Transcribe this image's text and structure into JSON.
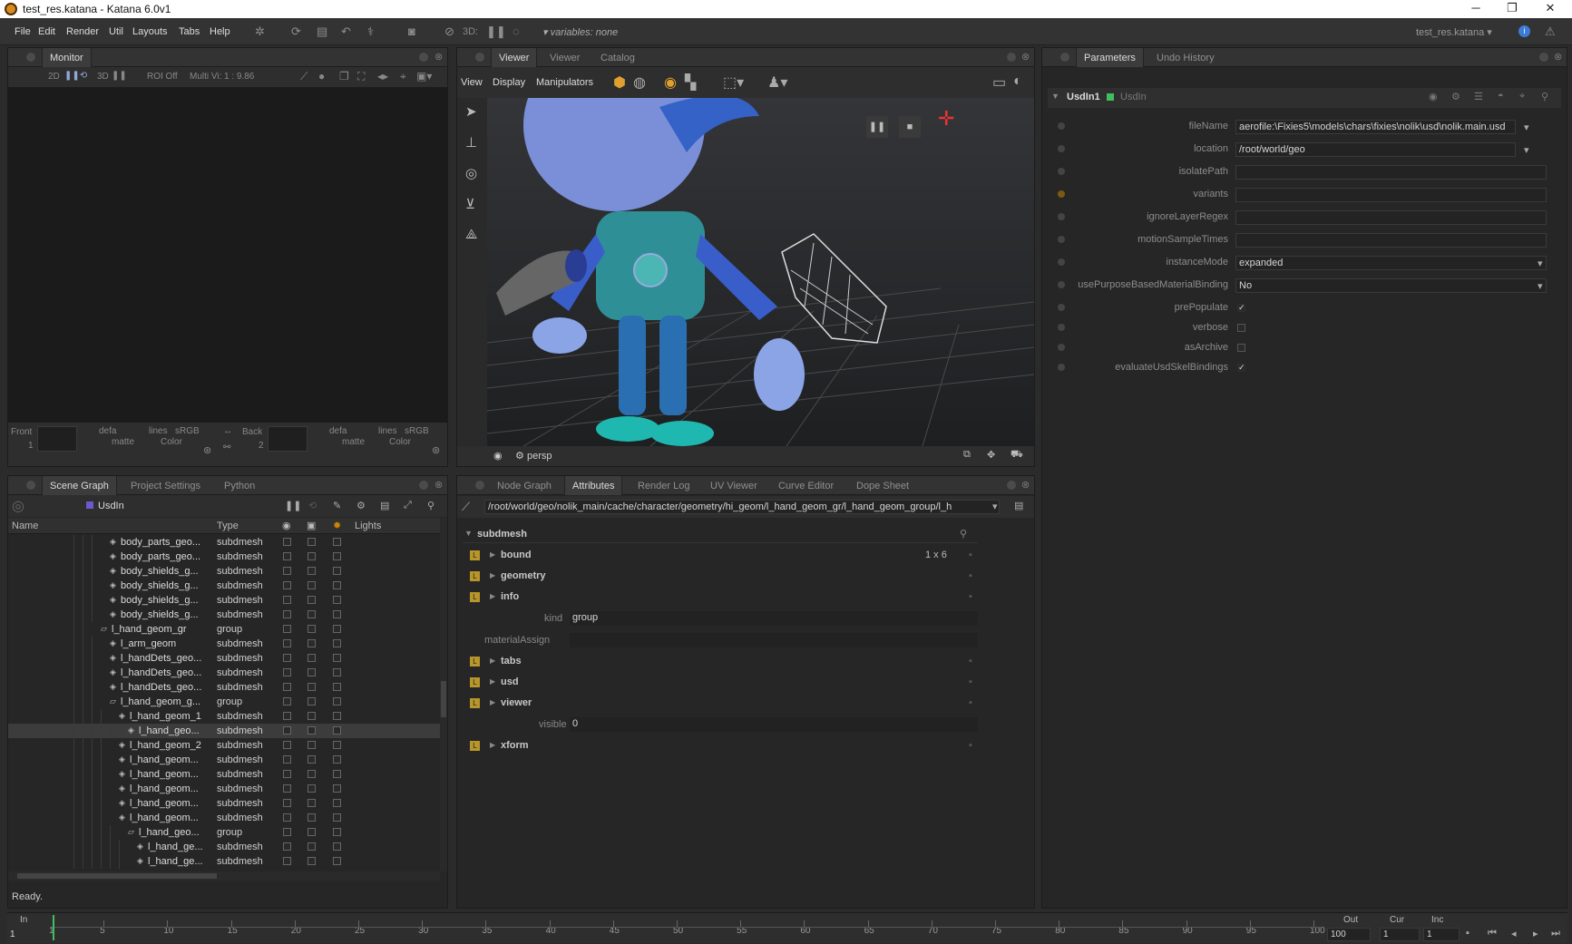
{
  "window": {
    "title": "test_res.katana - Katana 6.0v1",
    "minimize": "─",
    "restore": "❐",
    "close": "✕"
  },
  "menu": [
    "File",
    "Edit",
    "Render",
    "Util",
    "Layouts",
    "Tabs",
    "Help"
  ],
  "toolbar": {
    "mode_3d": "3D:",
    "variables": "variables: none",
    "project": "test_res.katana"
  },
  "monitor": {
    "tab": "Monitor",
    "mode2d": "2D",
    "mode3d": "3D",
    "roi": "ROI Off",
    "multi": "Multi Vi:",
    "zoom": "1 : 9.86",
    "front_label": "Front",
    "front_val": "1",
    "back_label": "Back",
    "back_val": "2",
    "defa": "defa",
    "lines": "lines",
    "srgb": "sRGB",
    "matte": "matte",
    "color": "Color"
  },
  "viewer": {
    "tabs": [
      "Viewer",
      "Viewer",
      "Catalog"
    ],
    "menus": [
      "View",
      "Display",
      "Manipulators"
    ],
    "camera": "persp"
  },
  "parameters": {
    "tabs": [
      "Parameters",
      "Undo History"
    ],
    "node_name": "UsdIn1",
    "node_type": "UsdIn",
    "params": [
      {
        "label": "fileName",
        "value": "aerofile:\\Fixies5\\models\\chars\\fixies\\nolik\\usd\\nolik.main.usd",
        "kind": "text"
      },
      {
        "label": "location",
        "value": "/root/world/geo",
        "kind": "text"
      },
      {
        "label": "isolatePath",
        "value": "",
        "kind": "text"
      },
      {
        "label": "variants",
        "value": "",
        "kind": "text"
      },
      {
        "label": "ignoreLayerRegex",
        "value": "",
        "kind": "text"
      },
      {
        "label": "motionSampleTimes",
        "value": "",
        "kind": "text"
      },
      {
        "label": "instanceMode",
        "value": "expanded",
        "kind": "dropdown"
      },
      {
        "label": "usePurposeBasedMaterialBinding",
        "value": "No",
        "kind": "dropdown"
      },
      {
        "label": "prePopulate",
        "value": "✓",
        "kind": "check"
      },
      {
        "label": "verbose",
        "value": "",
        "kind": "check"
      },
      {
        "label": "asArchive",
        "value": "",
        "kind": "check"
      },
      {
        "label": "evaluateUsdSkelBindings",
        "value": "✓",
        "kind": "check"
      }
    ]
  },
  "scenegraph": {
    "tabs": [
      "Scene Graph",
      "Project Settings",
      "Python"
    ],
    "node": "UsdIn",
    "columns": [
      "Name",
      "Type",
      "Lights"
    ],
    "rows": [
      {
        "name": "body_parts_geo...",
        "type": "subdmesh",
        "d": 3
      },
      {
        "name": "body_parts_geo...",
        "type": "subdmesh",
        "d": 3
      },
      {
        "name": "body_shields_g...",
        "type": "subdmesh",
        "d": 3
      },
      {
        "name": "body_shields_g...",
        "type": "subdmesh",
        "d": 3
      },
      {
        "name": "body_shields_g...",
        "type": "subdmesh",
        "d": 3
      },
      {
        "name": "body_shields_g...",
        "type": "subdmesh",
        "d": 3
      },
      {
        "name": "l_hand_geom_gr",
        "type": "group",
        "d": 2
      },
      {
        "name": "l_arm_geom",
        "type": "subdmesh",
        "d": 3
      },
      {
        "name": "l_handDets_geo...",
        "type": "subdmesh",
        "d": 3
      },
      {
        "name": "l_handDets_geo...",
        "type": "subdmesh",
        "d": 3
      },
      {
        "name": "l_handDets_geo...",
        "type": "subdmesh",
        "d": 3
      },
      {
        "name": "l_hand_geom_g...",
        "type": "group",
        "d": 3
      },
      {
        "name": "l_hand_geom_1",
        "type": "subdmesh",
        "d": 4
      },
      {
        "name": "l_hand_geo...",
        "type": "subdmesh",
        "d": 5
      },
      {
        "name": "l_hand_geom_2",
        "type": "subdmesh",
        "d": 4
      },
      {
        "name": "l_hand_geom...",
        "type": "subdmesh",
        "d": 4
      },
      {
        "name": "l_hand_geom...",
        "type": "subdmesh",
        "d": 4
      },
      {
        "name": "l_hand_geom...",
        "type": "subdmesh",
        "d": 4
      },
      {
        "name": "l_hand_geom...",
        "type": "subdmesh",
        "d": 4
      },
      {
        "name": "l_hand_geom...",
        "type": "subdmesh",
        "d": 4
      },
      {
        "name": "l_hand_geo...",
        "type": "group",
        "d": 5
      },
      {
        "name": "l_hand_ge...",
        "type": "subdmesh",
        "d": 6
      },
      {
        "name": "l_hand_ge...",
        "type": "subdmesh",
        "d": 6
      }
    ],
    "status": "Ready."
  },
  "attributes": {
    "tabs": [
      "Node Graph",
      "Attributes",
      "Render Log",
      "UV Viewer",
      "Curve Editor",
      "Dope Sheet"
    ],
    "path": "/root/world/geo/nolik_main/cache/character/geometry/hi_geom/l_hand_geom_gr/l_hand_geom_group/l_h",
    "section": "subdmesh",
    "groups": [
      {
        "name": "bound",
        "value": "1 x 6"
      },
      {
        "name": "geometry",
        "value": ""
      },
      {
        "name": "info",
        "value": ""
      }
    ],
    "kind_label": "kind",
    "kind_value": "group",
    "material_label": "materialAssign",
    "groups2": [
      "tabs",
      "usd",
      "viewer"
    ],
    "visible_label": "visible",
    "visible_value": "0",
    "groups3": [
      "xform"
    ]
  },
  "timeline": {
    "in_label": "In",
    "in_val": "1",
    "out_label": "Out",
    "out_val": "100",
    "cur_label": "Cur",
    "cur_val": "1",
    "inc_label": "Inc",
    "inc_val": "1",
    "ticks": [
      "1",
      "5",
      "10",
      "15",
      "20",
      "25",
      "30",
      "35",
      "40",
      "45",
      "50",
      "55",
      "60",
      "65",
      "70",
      "75",
      "80",
      "85",
      "90",
      "95",
      "100"
    ],
    "marker": "1"
  }
}
